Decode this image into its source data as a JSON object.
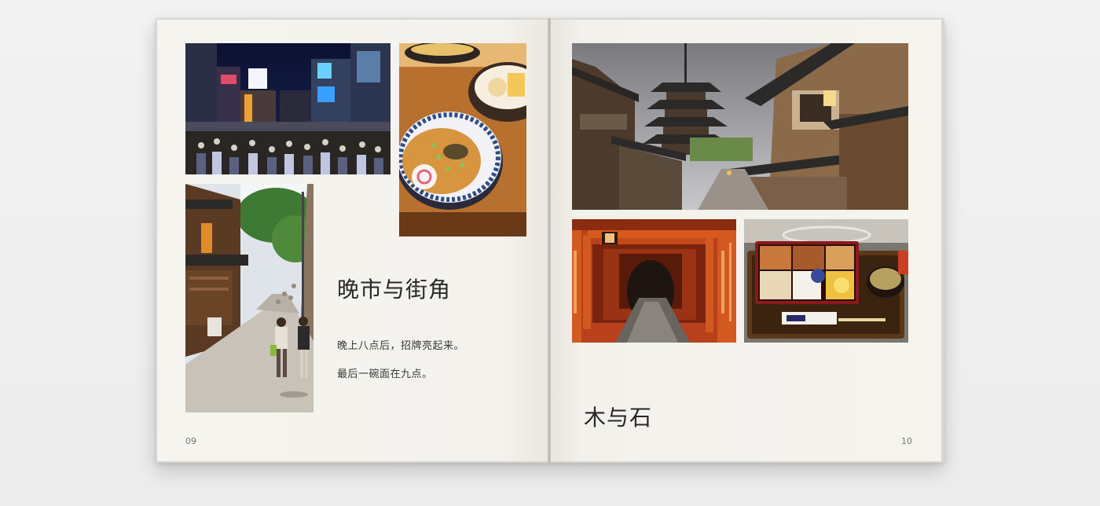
{
  "book": {
    "left_page": {
      "title": "晚市与街角",
      "caption_line_1": "晚上八点后，招牌亮起来。",
      "caption_line_2": "最后一碗面在九点。",
      "page_number": "09",
      "photos": [
        {
          "name": "night-crossing-photo"
        },
        {
          "name": "ramen-bowl-photo"
        },
        {
          "name": "old-street-photo"
        }
      ]
    },
    "right_page": {
      "title": "木与石",
      "page_number": "10",
      "photos": [
        {
          "name": "pagoda-street-photo"
        },
        {
          "name": "torii-gates-photo"
        },
        {
          "name": "bento-box-photo"
        }
      ]
    }
  },
  "colors": {
    "page": "#f5f3ee",
    "text": "#2a2825",
    "background": "#efefef"
  }
}
